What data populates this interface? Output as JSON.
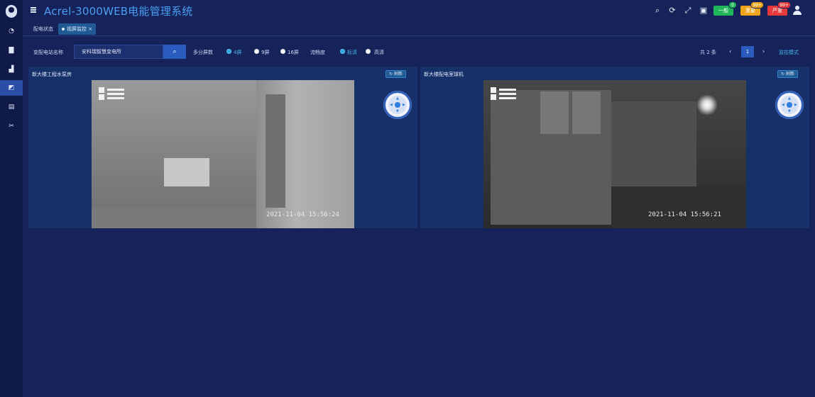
{
  "header": {
    "title": "Acrel-3000WEB电能管理系统",
    "alerts": [
      {
        "label": "一般",
        "count": "0",
        "color": "#21b65a"
      },
      {
        "label": "重要",
        "count": "99+",
        "color": "#f0a418"
      },
      {
        "label": "严重",
        "count": "99+",
        "color": "#e83a3a"
      }
    ]
  },
  "tabs": [
    {
      "label": "配电状态"
    },
    {
      "label": "视屏监控"
    }
  ],
  "filter": {
    "station_label": "变配电站名称",
    "station_value": "安科瑞智慧变电所",
    "split_label": "多分屏数",
    "split_options": [
      "4屏",
      "9屏",
      "16屏"
    ],
    "split_selected": "4屏",
    "stream_label": "流畅度",
    "stream_options": [
      "标清",
      "高清"
    ],
    "stream_selected": "标清",
    "pager_total": "共 2 条",
    "pager_current": "1",
    "monitor_mode": "监控模式"
  },
  "panels": [
    {
      "title": "新大楼工程水泵房",
      "refresh": "刷新",
      "timestamp": "2021-11-04 15:56:24"
    },
    {
      "title": "新大楼配电室球机",
      "refresh": "刷新",
      "timestamp": "2021-11-04 15:56:21"
    }
  ]
}
